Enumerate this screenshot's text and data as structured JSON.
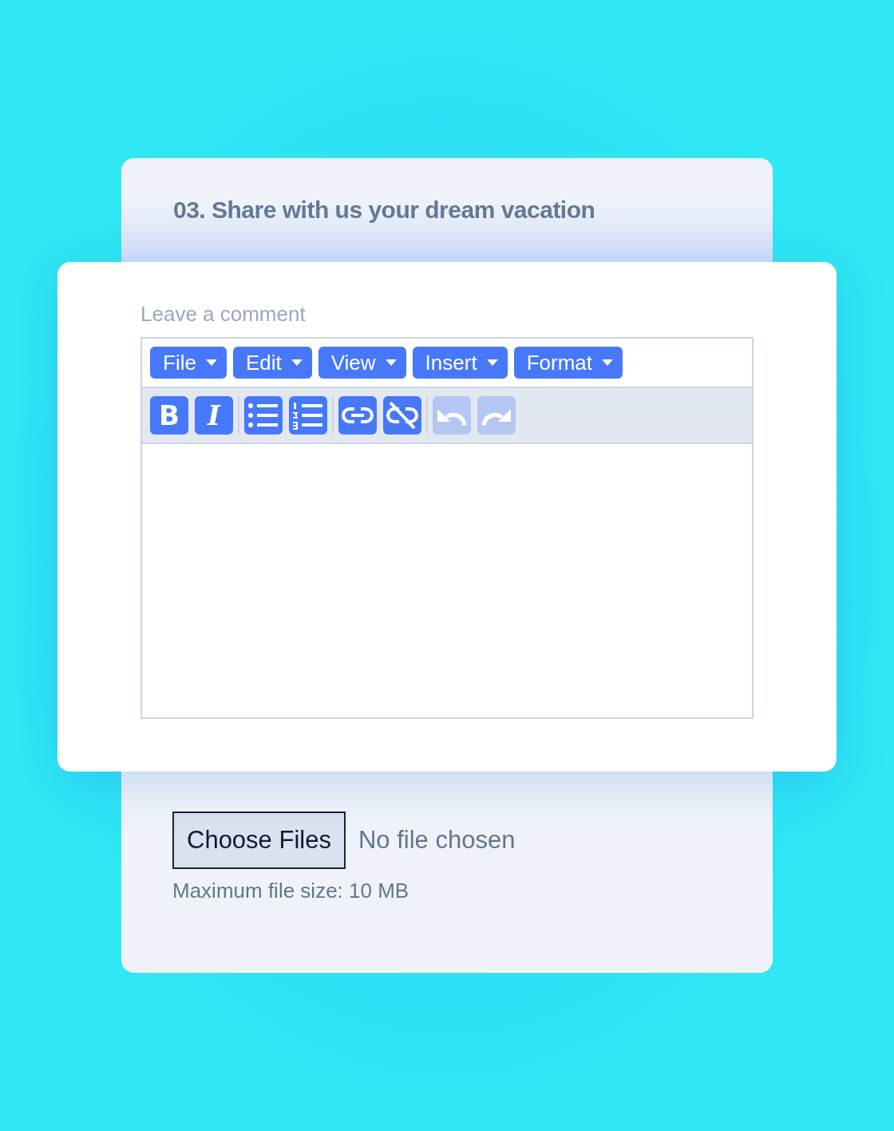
{
  "question": {
    "title": "03. Share with us your dream vacation"
  },
  "comment": {
    "label": "Leave a comment",
    "menus": [
      {
        "label": "File"
      },
      {
        "label": "Edit"
      },
      {
        "label": "View"
      },
      {
        "label": "Insert"
      },
      {
        "label": "Format"
      }
    ],
    "toolbar": [
      [
        {
          "kind": "bold",
          "label": "B",
          "disabled": false
        },
        {
          "kind": "italic",
          "label": "I",
          "disabled": false
        }
      ],
      [
        {
          "kind": "bullets",
          "disabled": false
        },
        {
          "kind": "numbers",
          "disabled": false
        }
      ],
      [
        {
          "kind": "link",
          "disabled": false
        },
        {
          "kind": "unlink",
          "disabled": false
        }
      ],
      [
        {
          "kind": "undo",
          "disabled": true
        },
        {
          "kind": "redo",
          "disabled": true
        }
      ]
    ]
  },
  "upload": {
    "button": "Choose Files",
    "status": "No file chosen",
    "hint": "Maximum file size: 10 MB"
  }
}
